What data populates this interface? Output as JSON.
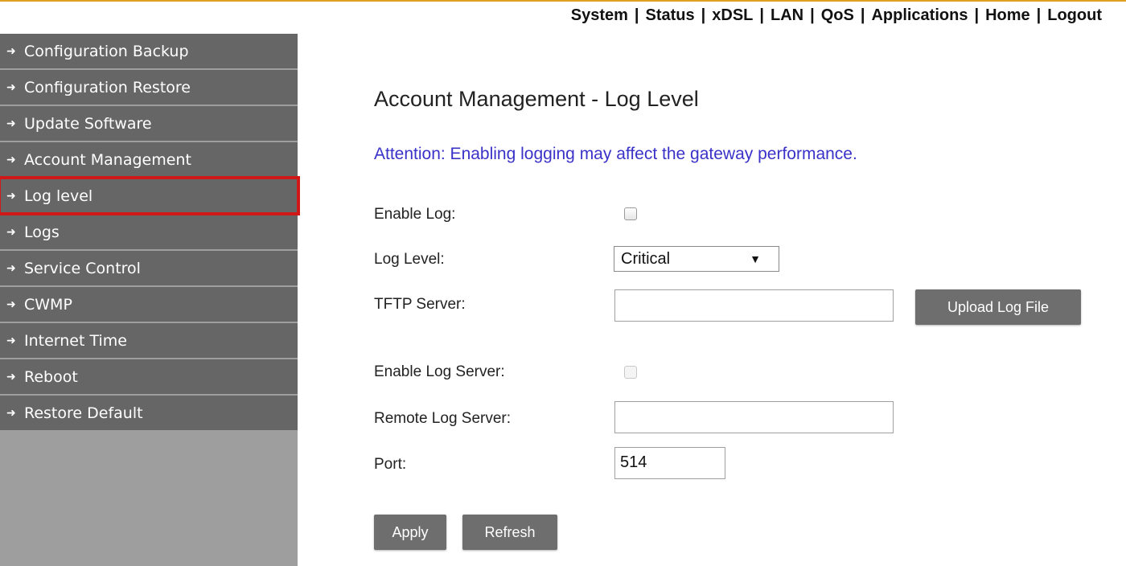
{
  "topnav": {
    "items": [
      "System",
      "Status",
      "xDSL",
      "LAN",
      "QoS",
      "Applications",
      "Home",
      "Logout"
    ],
    "separator": "|"
  },
  "sidebar": {
    "items": [
      {
        "label": "Configuration Backup"
      },
      {
        "label": "Configuration Restore"
      },
      {
        "label": "Update Software"
      },
      {
        "label": "Account Management"
      },
      {
        "label": "Log level",
        "active": true
      },
      {
        "label": "Logs"
      },
      {
        "label": "Service Control"
      },
      {
        "label": "CWMP"
      },
      {
        "label": "Internet Time"
      },
      {
        "label": "Reboot"
      },
      {
        "label": "Restore Default"
      }
    ]
  },
  "main": {
    "title": "Account Management - Log Level",
    "attention": "Attention: Enabling logging may affect the gateway performance.",
    "enable_log": {
      "label": "Enable Log:",
      "checked": false
    },
    "log_level": {
      "label": "Log Level:",
      "value": "Critical"
    },
    "tftp_server": {
      "label": "TFTP Server:",
      "value": ""
    },
    "upload_button": "Upload Log File",
    "enable_log_server": {
      "label": "Enable Log Server:",
      "checked": false,
      "disabled": true
    },
    "remote_log_server": {
      "label": "Remote Log Server:",
      "value": ""
    },
    "port": {
      "label": "Port:",
      "value": "514"
    },
    "apply_button": "Apply",
    "refresh_button": "Refresh"
  },
  "colors": {
    "attention": "#3a32c8",
    "sidebar_item": "#666666",
    "sidebar_bg": "#9e9e9e",
    "active_outline": "#d01818",
    "button": "#6e6e6e"
  }
}
